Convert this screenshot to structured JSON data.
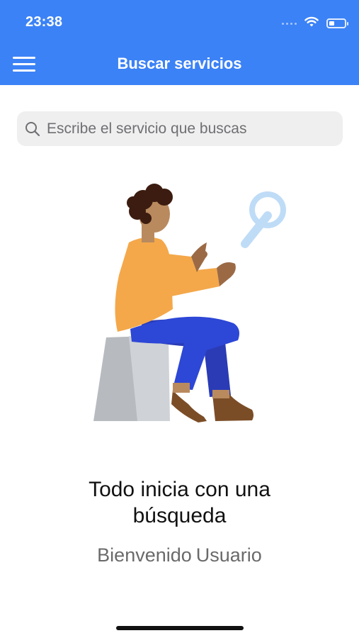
{
  "status_bar": {
    "time": "23:38",
    "wifi_icon": "wifi-icon",
    "battery_icon": "battery-icon"
  },
  "header": {
    "menu_icon": "hamburger-menu-icon",
    "title": "Buscar servicios",
    "background_color": "#3b82f6"
  },
  "search": {
    "placeholder": "Escribe el servicio que buscas",
    "value": "",
    "icon": "search-icon"
  },
  "illustration": {
    "name": "person-seated-with-magnifier-illustration"
  },
  "empty_state": {
    "headline_line1": "Todo inicia con una",
    "headline_line2": "búsqueda",
    "greeting_word": "Bienvenido",
    "user_name": "Usuario"
  }
}
